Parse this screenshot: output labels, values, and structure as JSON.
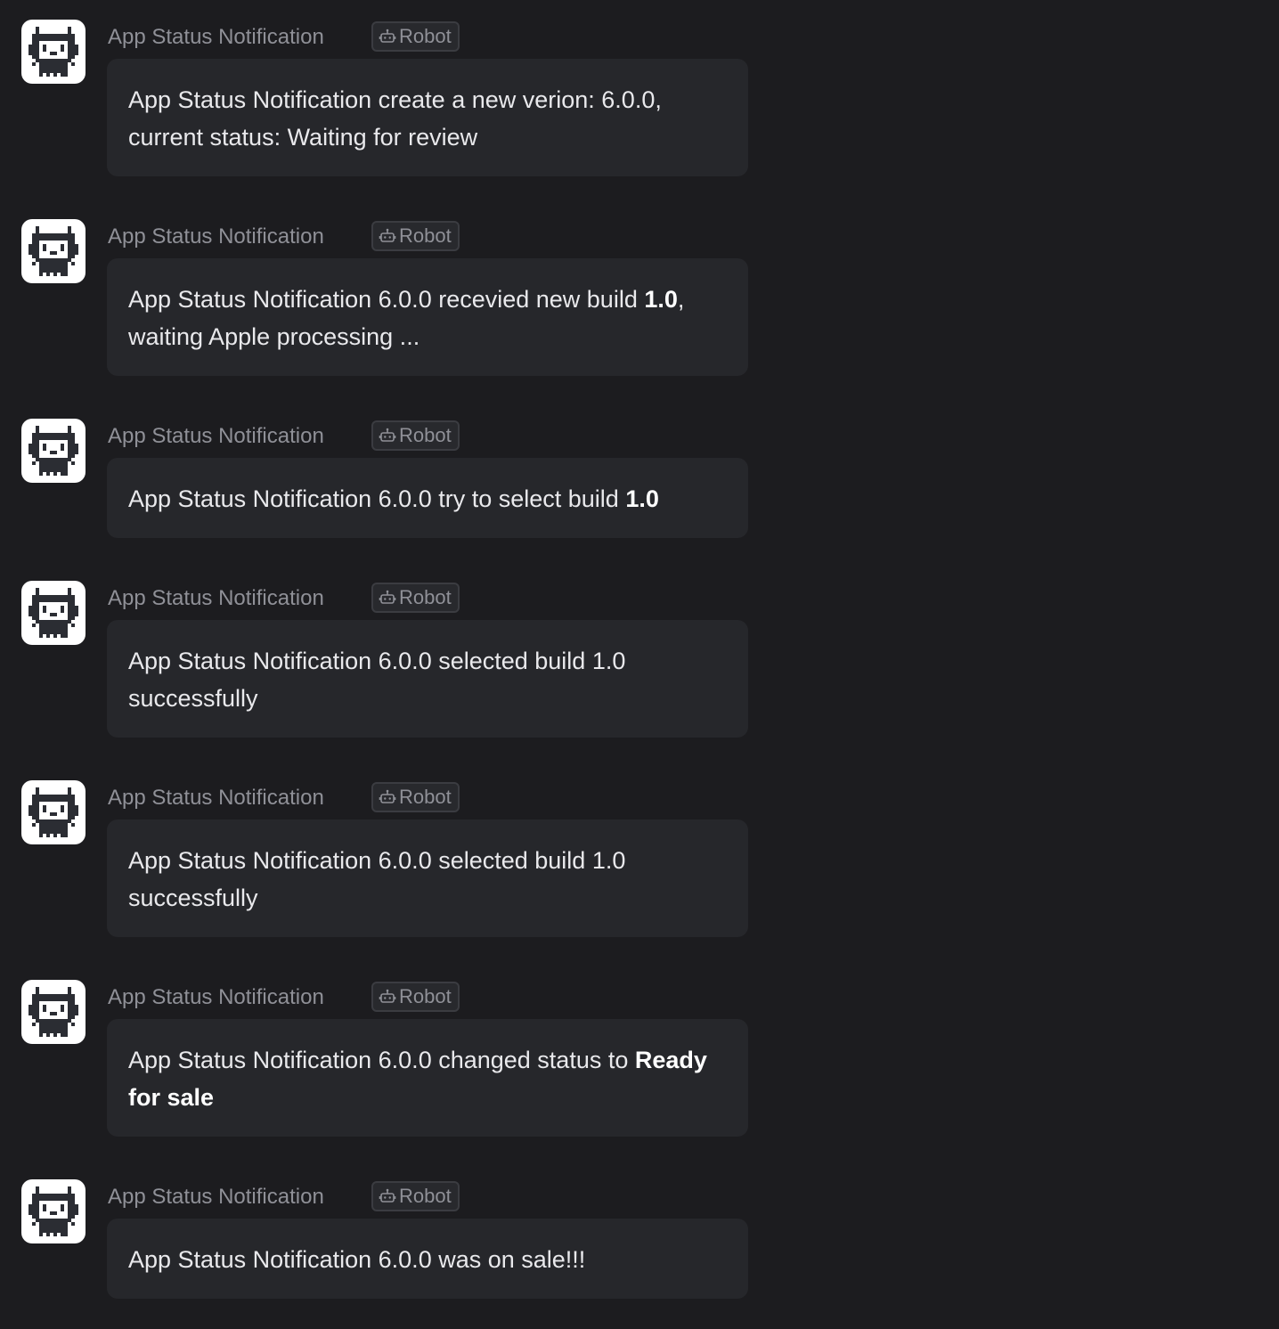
{
  "feed": {
    "messages": [
      {
        "sender": "App Status Notification",
        "badge": "Robot",
        "segments": [
          {
            "text": "App Status Notification create a new verion: 6.0.0, current status: Waiting for review",
            "bold": false
          }
        ]
      },
      {
        "sender": "App Status Notification",
        "badge": "Robot",
        "segments": [
          {
            "text": "App Status Notification 6.0.0 recevied new build ",
            "bold": false
          },
          {
            "text": "1.0",
            "bold": true
          },
          {
            "text": ", waiting Apple processing ...",
            "bold": false
          }
        ]
      },
      {
        "sender": "App Status Notification",
        "badge": "Robot",
        "segments": [
          {
            "text": "App Status Notification 6.0.0 try to select build ",
            "bold": false
          },
          {
            "text": "1.0",
            "bold": true
          }
        ]
      },
      {
        "sender": "App Status Notification",
        "badge": "Robot",
        "segments": [
          {
            "text": "App Status Notification 6.0.0 selected build 1.0 successfully",
            "bold": false
          }
        ]
      },
      {
        "sender": "App Status Notification",
        "badge": "Robot",
        "segments": [
          {
            "text": "App Status Notification 6.0.0 selected build 1.0 successfully",
            "bold": false
          }
        ]
      },
      {
        "sender": "App Status Notification",
        "badge": "Robot",
        "segments": [
          {
            "text": "App Status Notification 6.0.0 changed status to ",
            "bold": false
          },
          {
            "text": "Ready for sale",
            "bold": true
          }
        ]
      },
      {
        "sender": "App Status Notification",
        "badge": "Robot",
        "segments": [
          {
            "text": "App Status Notification 6.0.0 was on sale!!!",
            "bold": false
          }
        ]
      }
    ]
  },
  "icons": {
    "avatar": "pixel-cat-avatar-icon",
    "badge": "robot-icon"
  },
  "colors": {
    "background": "#1c1c1f",
    "bubble": "#26272b",
    "message_text": "#e9e9ec",
    "sender_text": "#8f9097",
    "badge_border": "#3b3c41"
  }
}
